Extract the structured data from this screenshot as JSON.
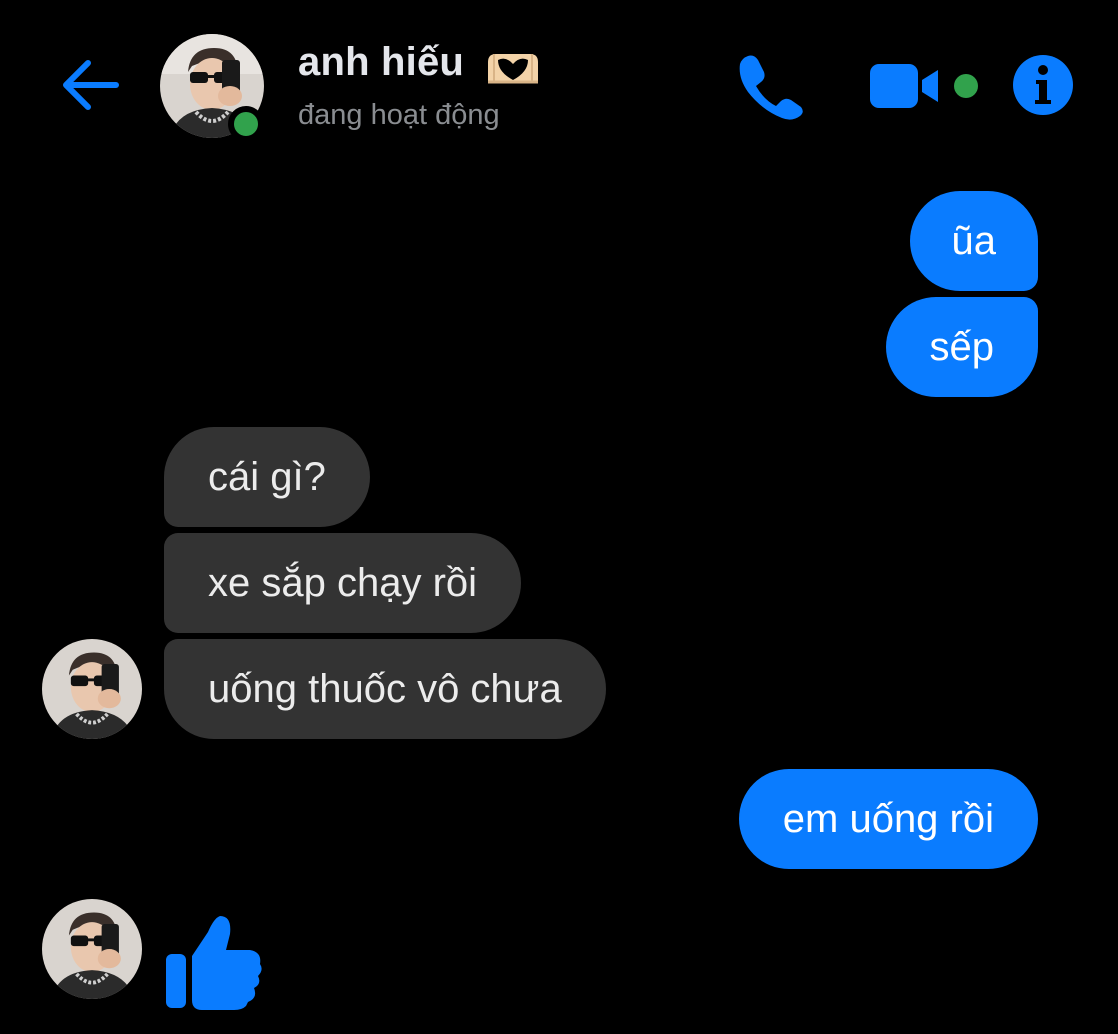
{
  "header": {
    "contact_name": "anh hiếu",
    "status": "đang hoạt động",
    "icons": {
      "back": "arrow-left-icon",
      "call": "phone-icon",
      "video": "video-camera-icon",
      "info": "info-icon",
      "name_emoji": "heart-hands-emoji"
    }
  },
  "messages": [
    {
      "sender": "me",
      "text": "ũa"
    },
    {
      "sender": "me",
      "text": "sếp"
    },
    {
      "sender": "contact",
      "text": "cái gì?"
    },
    {
      "sender": "contact",
      "text": "xe sắp chạy rồi"
    },
    {
      "sender": "contact",
      "text": "uống thuốc vô chưa"
    },
    {
      "sender": "me",
      "text": "em uống rồi"
    },
    {
      "sender": "contact",
      "sticker": "thumbs-up-icon"
    }
  ],
  "colors": {
    "background": "#000000",
    "accent": "#0a7cff",
    "incoming_bubble": "#333333",
    "online": "#31a24c",
    "status_text": "#8a8d91"
  }
}
